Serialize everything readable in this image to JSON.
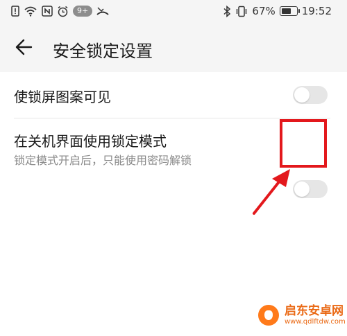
{
  "status_bar": {
    "notification_badge": "9+",
    "battery_percent": "67%",
    "battery_level": 0.67,
    "time": "19:52",
    "icons_left": [
      "sim-alert-icon",
      "wifi-icon",
      "nfc-icon",
      "alarm-icon",
      "notification-badge",
      "missed-call-icon"
    ],
    "icons_right": [
      "bluetooth-icon",
      "vibrate-icon",
      "battery-icon"
    ]
  },
  "app_bar": {
    "back_icon": "arrow-left-icon",
    "title": "安全锁定设置"
  },
  "settings": {
    "items": [
      {
        "title": "使锁屏图案可见",
        "subtitle": "",
        "enabled": false
      },
      {
        "title": "在关机界面使用锁定模式",
        "subtitle": "锁定模式开启后，只能使用密码解锁",
        "enabled": false
      }
    ]
  },
  "annotation": {
    "color": "#e3181c"
  },
  "watermark": {
    "text": "启东安卓网",
    "url": "www.qdlftdw.com"
  }
}
